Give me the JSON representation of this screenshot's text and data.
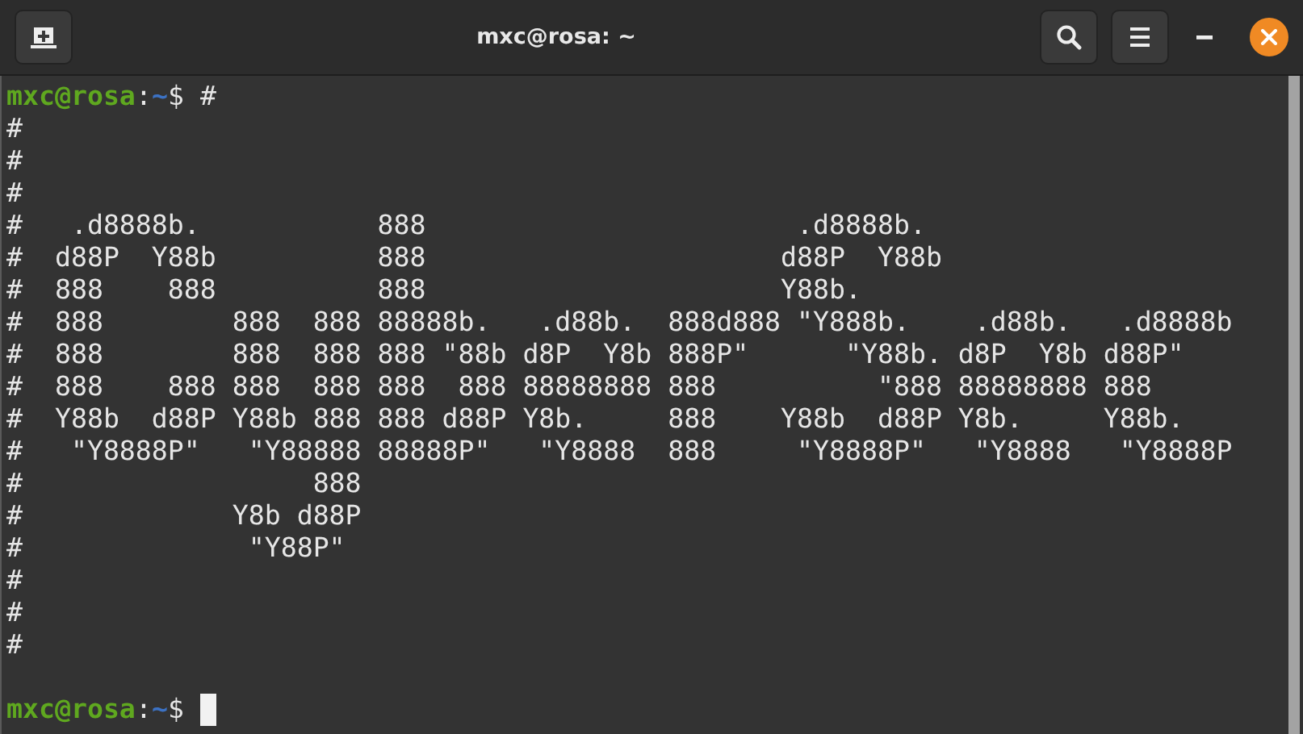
{
  "window": {
    "title": "mxc@rosa: ~"
  },
  "terminal": {
    "lines": [
      {
        "kind": "prompt",
        "user_host": "mxc@rosa",
        "separator": ":",
        "path": "~",
        "symbol": "$",
        "command": "#",
        "cursor": false
      },
      {
        "kind": "output",
        "text": "#"
      },
      {
        "kind": "output",
        "text": "#"
      },
      {
        "kind": "output",
        "text": "#"
      },
      {
        "kind": "output",
        "text": "#   .d8888b.           888                       .d8888b."
      },
      {
        "kind": "output",
        "text": "#  d88P  Y88b          888                      d88P  Y88b"
      },
      {
        "kind": "output",
        "text": "#  888    888          888                      Y88b."
      },
      {
        "kind": "output",
        "text": "#  888        888  888 88888b.   .d88b.  888d888 \"Y888b.    .d88b.   .d8888b"
      },
      {
        "kind": "output",
        "text": "#  888        888  888 888 \"88b d8P  Y8b 888P\"      \"Y88b. d8P  Y8b d88P\""
      },
      {
        "kind": "output",
        "text": "#  888    888 888  888 888  888 88888888 888          \"888 88888888 888"
      },
      {
        "kind": "output",
        "text": "#  Y88b  d88P Y88b 888 888 d88P Y8b.     888    Y88b  d88P Y8b.     Y88b."
      },
      {
        "kind": "output",
        "text": "#   \"Y8888P\"   \"Y88888 88888P\"   \"Y8888  888     \"Y8888P\"   \"Y8888   \"Y8888P"
      },
      {
        "kind": "output",
        "text": "#                  888"
      },
      {
        "kind": "output",
        "text": "#             Y8b d88P"
      },
      {
        "kind": "output",
        "text": "#              \"Y88P\""
      },
      {
        "kind": "output",
        "text": "#"
      },
      {
        "kind": "output",
        "text": "#"
      },
      {
        "kind": "output",
        "text": "#"
      },
      {
        "kind": "blank"
      },
      {
        "kind": "prompt",
        "user_host": "mxc@rosa",
        "separator": ":",
        "path": "~",
        "symbol": "$",
        "cursor": true
      }
    ]
  }
}
